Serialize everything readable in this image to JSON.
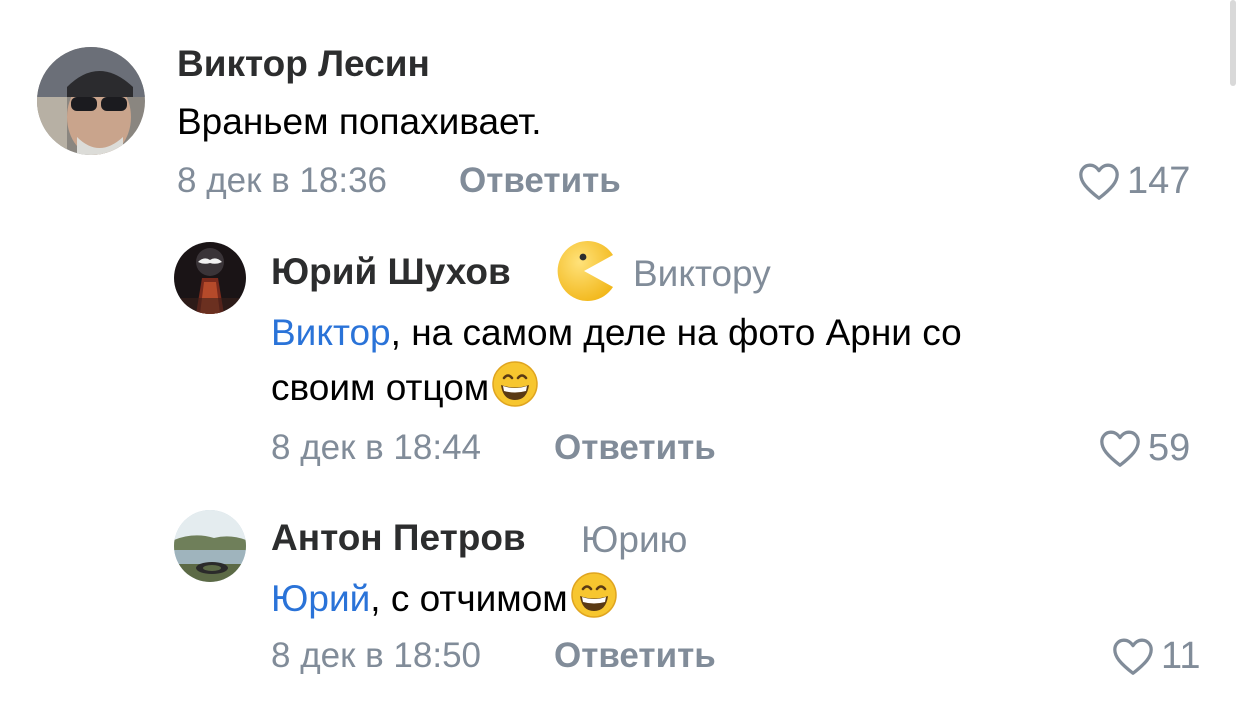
{
  "comments": [
    {
      "author": "Виктор Лесин",
      "text": "Враньем попахивает.",
      "date": "8 дек в 18:36",
      "reply_label": "Ответить",
      "likes": "147"
    },
    {
      "author": "Юрий Шухов",
      "reply_to": "Виктору",
      "mention": "Виктор",
      "text_line1": ", на самом деле на фото Арни со",
      "text_line2": "своим отцом",
      "emoji": "grinning-face-icon",
      "date": "8 дек в 18:44",
      "reply_label": "Ответить",
      "likes": "59"
    },
    {
      "author": "Антон Петров",
      "reply_to": "Юрию",
      "mention": "Юрий",
      "text": ", с отчимом",
      "emoji": "grinning-face-icon",
      "date": "8 дек в 18:50",
      "reply_label": "Ответить",
      "likes": "11"
    }
  ],
  "colors": {
    "name": "#2c2d2e",
    "secondary": "#818c99",
    "mention": "#2a73d8"
  }
}
